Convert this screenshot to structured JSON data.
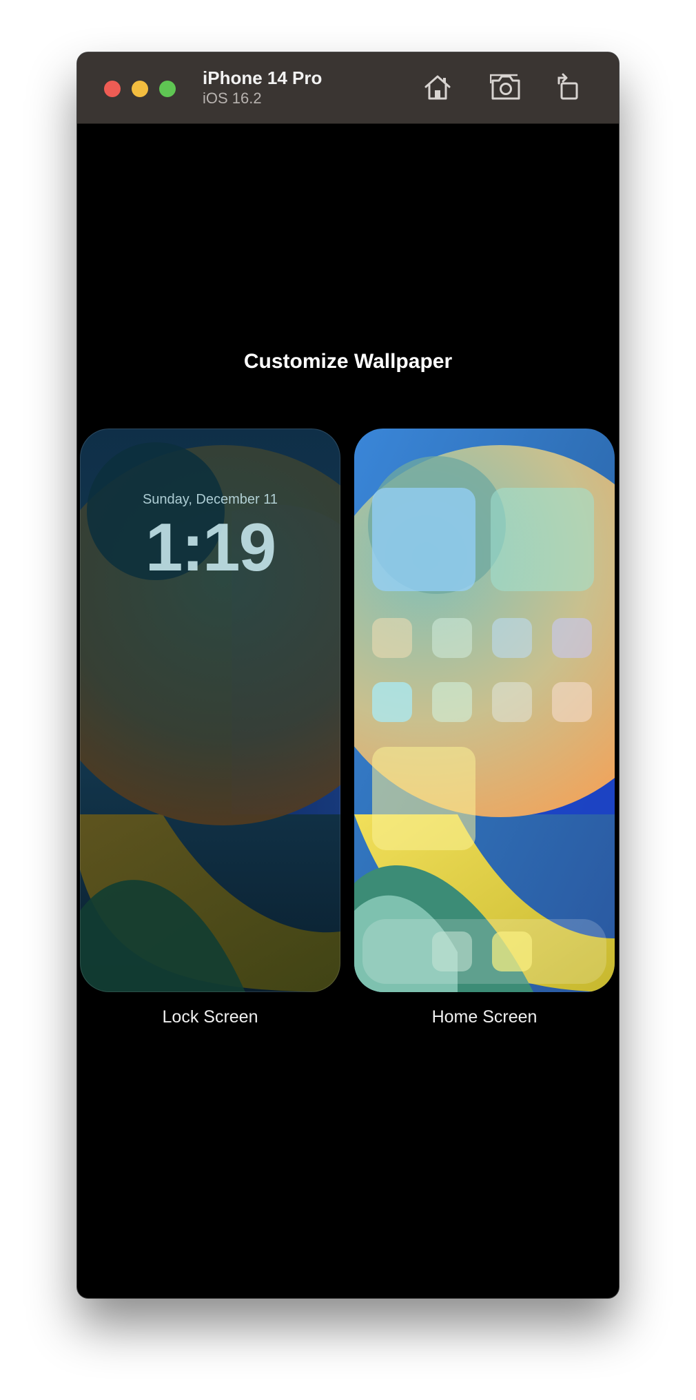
{
  "window": {
    "device_name": "iPhone 14 Pro",
    "os_version": "iOS 16.2"
  },
  "toolbar": {
    "home_icon": "home-icon",
    "screenshot_icon": "camera-icon",
    "rotate_icon": "rotate-icon"
  },
  "screen": {
    "title": "Customize Wallpaper",
    "lock_screen": {
      "date": "Sunday, December 11",
      "time": "1:19",
      "label": "Lock Screen"
    },
    "home_screen": {
      "label": "Home Screen"
    }
  },
  "colors": {
    "traffic_red": "#ee5c54",
    "traffic_yellow": "#f3bd3f",
    "traffic_green": "#5fc653",
    "titlebar": "#3a3532"
  }
}
